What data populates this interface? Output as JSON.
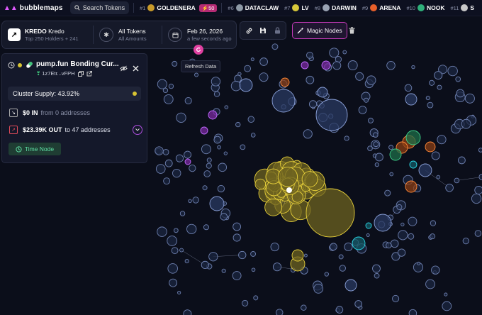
{
  "topbar": {
    "brand": "bubblemaps",
    "search_label": "Search Tokens",
    "tokens": [
      {
        "rank": "#1",
        "name": "GOLDENERA",
        "color": "#c89a2a",
        "badge": "50"
      },
      {
        "rank": "#6",
        "name": "DATACLAW",
        "color": "#8e9aa6"
      },
      {
        "rank": "#7",
        "name": "LV",
        "color": "#d7c83a"
      },
      {
        "rank": "#8",
        "name": "DARWIN",
        "color": "#9aa3b3"
      },
      {
        "rank": "#9",
        "name": "ARENA",
        "color": "#e8602a"
      },
      {
        "rank": "#10",
        "name": "NOOK",
        "color": "#2fb07a"
      },
      {
        "rank": "#11",
        "name": "S",
        "color": "#c8c8c8"
      }
    ]
  },
  "infobar": {
    "token_symbol": "KREDO",
    "token_name": "Kredo",
    "holders": "Top 250 Holders + 241",
    "filter_title": "All Tokens",
    "filter_sub": "All Amounts",
    "date": "Feb 26, 2026",
    "date_sub": "a few seconds ago"
  },
  "toolbar": {
    "magic_label": "Magic Nodes",
    "refresh_tooltip": "Refresh Data"
  },
  "panel": {
    "title": "pump.fun Bonding Cur...",
    "address": "1z7Etr...vFPH",
    "cluster_supply": "Cluster Supply: 43.92%",
    "in_amount": "$0 IN",
    "in_from": "from 0 addresses",
    "out_amount": "$23.39K OUT",
    "out_to": "to 47 addresses",
    "time_node_label": "Time Node"
  },
  "colors": {
    "background": "#0b0e1a",
    "accent_pink": "#e040a0",
    "bubble_yellow": "#d8c433",
    "bubble_blue": "#3a4d78",
    "bubble_purple": "#b04fe0",
    "bubble_orange": "#e8702a",
    "bubble_green": "#2fb07a",
    "bubble_teal": "#2ac0d0"
  }
}
